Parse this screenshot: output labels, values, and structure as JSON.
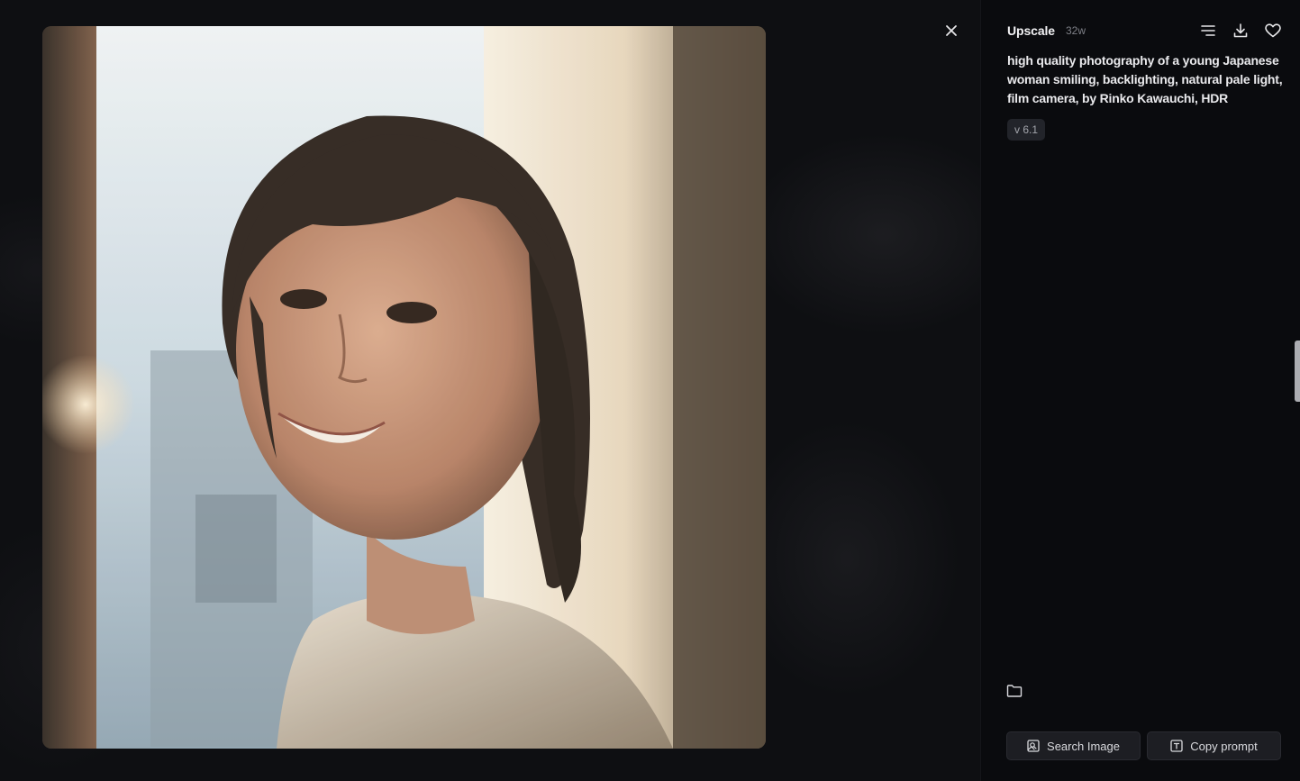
{
  "viewer": {
    "image_alt": "high quality photography of a young Japanese woman smiling, backlighting, natural pale light, film camera, by Rinko Kawauchi, HDR"
  },
  "icons": {
    "close": "close-icon",
    "options": "options-icon",
    "download": "download-icon",
    "like": "heart-icon",
    "folder": "folder-icon",
    "search_image": "image-search-icon",
    "copy_prompt": "text-box-icon"
  },
  "panel": {
    "title": "Upscale",
    "age": "32w",
    "prompt": "high quality photography of a young Japanese woman smiling, backlighting, natural pale light, film camera, by Rinko Kawauchi, HDR",
    "version": "v 6.1"
  },
  "actions": {
    "search_image": "Search Image",
    "copy_prompt": "Copy prompt"
  },
  "colors": {
    "background": "#0b0c0f",
    "panel": "#0a0b0e",
    "button": "#1d1e23",
    "text": "#e9e9ec",
    "muted": "#7d7f86"
  }
}
